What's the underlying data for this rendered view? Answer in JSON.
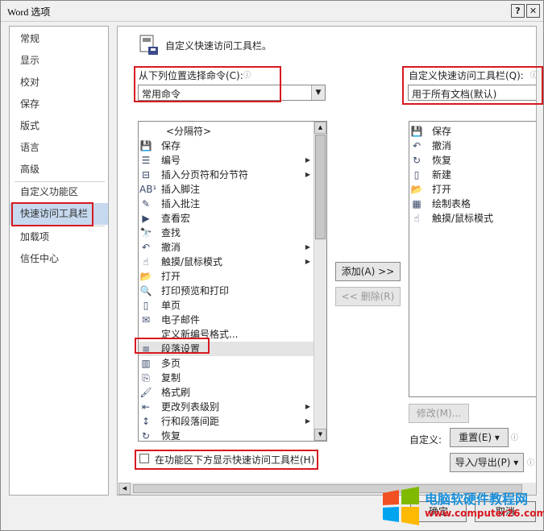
{
  "window": {
    "title": "Word 选项",
    "help": "?",
    "close": "✕"
  },
  "sidebar": {
    "items": [
      {
        "label": "常规"
      },
      {
        "label": "显示"
      },
      {
        "label": "校对"
      },
      {
        "label": "保存"
      },
      {
        "label": "版式"
      },
      {
        "label": "语言"
      },
      {
        "label": "高级"
      },
      {
        "label": "自定义功能区"
      },
      {
        "label": "快速访问工具栏"
      },
      {
        "label": "加载项"
      },
      {
        "label": "信任中心"
      }
    ],
    "selected": "快速访问工具栏"
  },
  "main": {
    "heading": "自定义快速访问工具栏。",
    "choose_label": "从下列位置选择命令(C):",
    "choose_value": "常用命令",
    "customize_label": "自定义快速访问工具栏(Q):",
    "customize_value": "用于所有文档(默认)",
    "commands": [
      {
        "icon": "",
        "label": "<分隔符>",
        "sub": ""
      },
      {
        "icon": "💾",
        "label": "保存",
        "sub": ""
      },
      {
        "icon": "☰",
        "label": "编号",
        "sub": "▶"
      },
      {
        "icon": "⊟",
        "label": "插入分页符和分节符",
        "sub": "▶"
      },
      {
        "icon": "AB¹",
        "label": "插入脚注",
        "sub": ""
      },
      {
        "icon": "✎",
        "label": "插入批注",
        "sub": ""
      },
      {
        "icon": "▶",
        "label": "查看宏",
        "sub": ""
      },
      {
        "icon": "🔭",
        "label": "查找",
        "sub": ""
      },
      {
        "icon": "↶",
        "label": "撤消",
        "sub": "▶"
      },
      {
        "icon": "☝",
        "label": "触摸/鼠标模式",
        "sub": "▶"
      },
      {
        "icon": "📂",
        "label": "打开",
        "sub": ""
      },
      {
        "icon": "🔍",
        "label": "打印预览和打印",
        "sub": ""
      },
      {
        "icon": "▯",
        "label": "单页",
        "sub": ""
      },
      {
        "icon": "✉",
        "label": "电子邮件",
        "sub": ""
      },
      {
        "icon": "",
        "label": "定义新编号格式...",
        "sub": ""
      },
      {
        "icon": "≡",
        "label": "段落设置",
        "sub": ""
      },
      {
        "icon": "▥",
        "label": "多页",
        "sub": ""
      },
      {
        "icon": "⎘",
        "label": "复制",
        "sub": ""
      },
      {
        "icon": "🖌",
        "label": "格式刷",
        "sub": ""
      },
      {
        "icon": "⇤",
        "label": "更改列表级别",
        "sub": "▶"
      },
      {
        "icon": "↕",
        "label": "行和段落间距",
        "sub": "▶"
      },
      {
        "icon": "↻",
        "label": "恢复",
        "sub": ""
      }
    ],
    "toolbar_items": [
      {
        "icon": "💾",
        "label": "保存"
      },
      {
        "icon": "↶",
        "label": "撤消"
      },
      {
        "icon": "↻",
        "label": "恢复"
      },
      {
        "icon": "▯",
        "label": "新建"
      },
      {
        "icon": "📂",
        "label": "打开"
      },
      {
        "icon": "▦",
        "label": "绘制表格"
      },
      {
        "icon": "☝",
        "label": "触摸/鼠标模式"
      }
    ],
    "add_button": "添加(A) >>",
    "remove_button": "<< 删除(R)",
    "show_below_label": "在功能区下方显示快速访问工具栏(H)",
    "modify_button": "修改(M)...",
    "customize_text": "自定义:",
    "reset_button": "重置(E) ▾",
    "import_export_button": "导入/导出(P) ▾"
  },
  "footer": {
    "ok": "确定",
    "cancel": "取消"
  },
  "watermark": {
    "text": "电脑软硬件教程网",
    "url": "www.computer26.com"
  }
}
